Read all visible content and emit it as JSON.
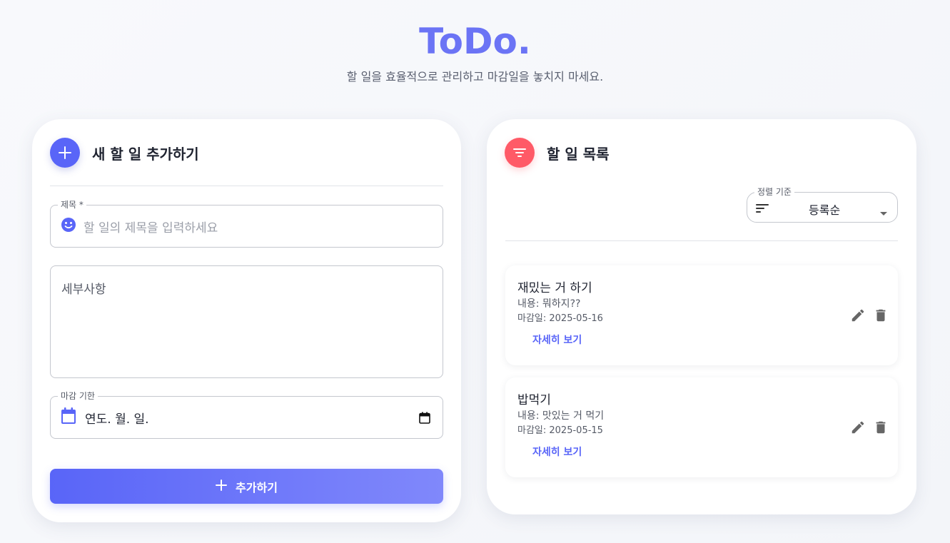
{
  "header": {
    "title": "ToDo.",
    "subtitle": "할 일을 효율적으로 관리하고 마감일을 놓치지 마세요."
  },
  "add_form": {
    "heading": "새 할 일 추가하기",
    "title_field": {
      "label": "제목 *",
      "placeholder": "할 일의 제목을 입력하세요",
      "icon": "smiley-icon"
    },
    "details_field": {
      "placeholder": "세부사항"
    },
    "due_field": {
      "label": "마감 기한",
      "value": "연도. 월. 일.",
      "icon": "calendar-icon"
    },
    "submit_label": "추가하기"
  },
  "todo_list": {
    "heading": "할 일 목록",
    "sort": {
      "label": "정렬 기준",
      "value": "등록순"
    },
    "items": [
      {
        "title": "재밌는 거 하기",
        "content": "내용: 뭐하지??",
        "due": "마감일: 2025-05-16",
        "detail_label": "자세히 보기"
      },
      {
        "title": "밥먹기",
        "content": "내용: 맛있는 거 먹기",
        "due": "마감일: 2025-05-15",
        "detail_label": "자세히 보기"
      }
    ]
  },
  "colors": {
    "accent": "#5965f8",
    "title": "#6b74f5",
    "danger": "#ff5a67"
  }
}
